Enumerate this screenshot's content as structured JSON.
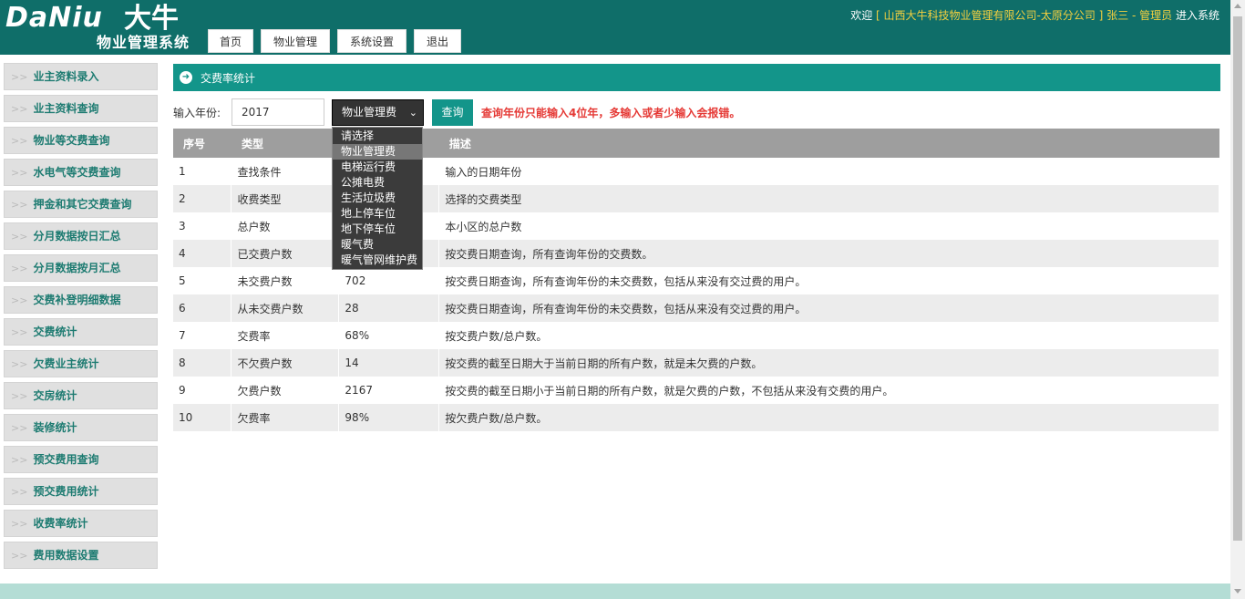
{
  "header": {
    "logo_latin": "DaNiu",
    "logo_cn": "大牛",
    "logo_subtitle": "物业管理系统",
    "nav": [
      "首页",
      "物业管理",
      "系统设置",
      "退出"
    ],
    "welcome_prefix": "欢迎",
    "company": "[ 山西大牛科技物业管理有限公司-太原分公司 ]",
    "user": "张三 - 管理员",
    "enter": "进入系统"
  },
  "sidebar": {
    "arrow": ">>",
    "items": [
      "业主资料录入",
      "业主资料查询",
      "物业等交费查询",
      "水电气等交费查询",
      "押金和其它交费查询",
      "分月数据按日汇总",
      "分月数据按月汇总",
      "交费补登明细数据",
      "交费统计",
      "欠费业主统计",
      "交房统计",
      "装修统计",
      "预交费用查询",
      "预交费用统计",
      "收费率统计",
      "费用数据设置"
    ]
  },
  "main": {
    "title": "交费率统计",
    "year_label": "输入年份:",
    "year_value": "2017",
    "select_value": "物业管理费",
    "query_label": "查询",
    "hint": "查询年份只能输入4位年，多输入或者少输入会报错。"
  },
  "dropdown": {
    "options": [
      "请选择",
      "物业管理费",
      "电梯运行费",
      "公摊电费",
      "生活垃圾费",
      "地上停车位",
      "地下停车位",
      "暖气费",
      "暖气管网维护费"
    ],
    "selected": "物业管理费"
  },
  "table": {
    "headers": [
      "序号",
      "类型",
      "",
      "描述"
    ],
    "rows": [
      [
        "1",
        "查找条件",
        "",
        "输入的日期年份"
      ],
      [
        "2",
        "收费类型",
        "",
        "选择的交费类型"
      ],
      [
        "3",
        "总户数",
        "",
        "本小区的总户数"
      ],
      [
        "4",
        "已交费户数",
        "",
        "按交费日期查询，所有查询年份的交费数。"
      ],
      [
        "5",
        "未交费户数",
        "702",
        "按交费日期查询，所有查询年份的未交费数，包括从来没有交过费的用户。"
      ],
      [
        "6",
        "从未交费户数",
        "28",
        "按交费日期查询，所有查询年份的未交费数，包括从来没有交过费的用户。"
      ],
      [
        "7",
        "交费率",
        "68%",
        "按交费户数/总户数。"
      ],
      [
        "8",
        "不欠费户数",
        "14",
        "按交费的截至日期大于当前日期的所有户数，就是未欠费的户数。"
      ],
      [
        "9",
        "欠费户数",
        "2167",
        "按交费的截至日期小于当前日期的所有户数，就是欠费的户数，不包括从来没有交费的用户。"
      ],
      [
        "10",
        "欠费率",
        "98%",
        "按欠费户数/总户数。"
      ]
    ]
  },
  "colors": {
    "header_bg": "#0f6e69",
    "accent": "#13958a",
    "hint": "#e53935",
    "company": "#f4d03f"
  }
}
